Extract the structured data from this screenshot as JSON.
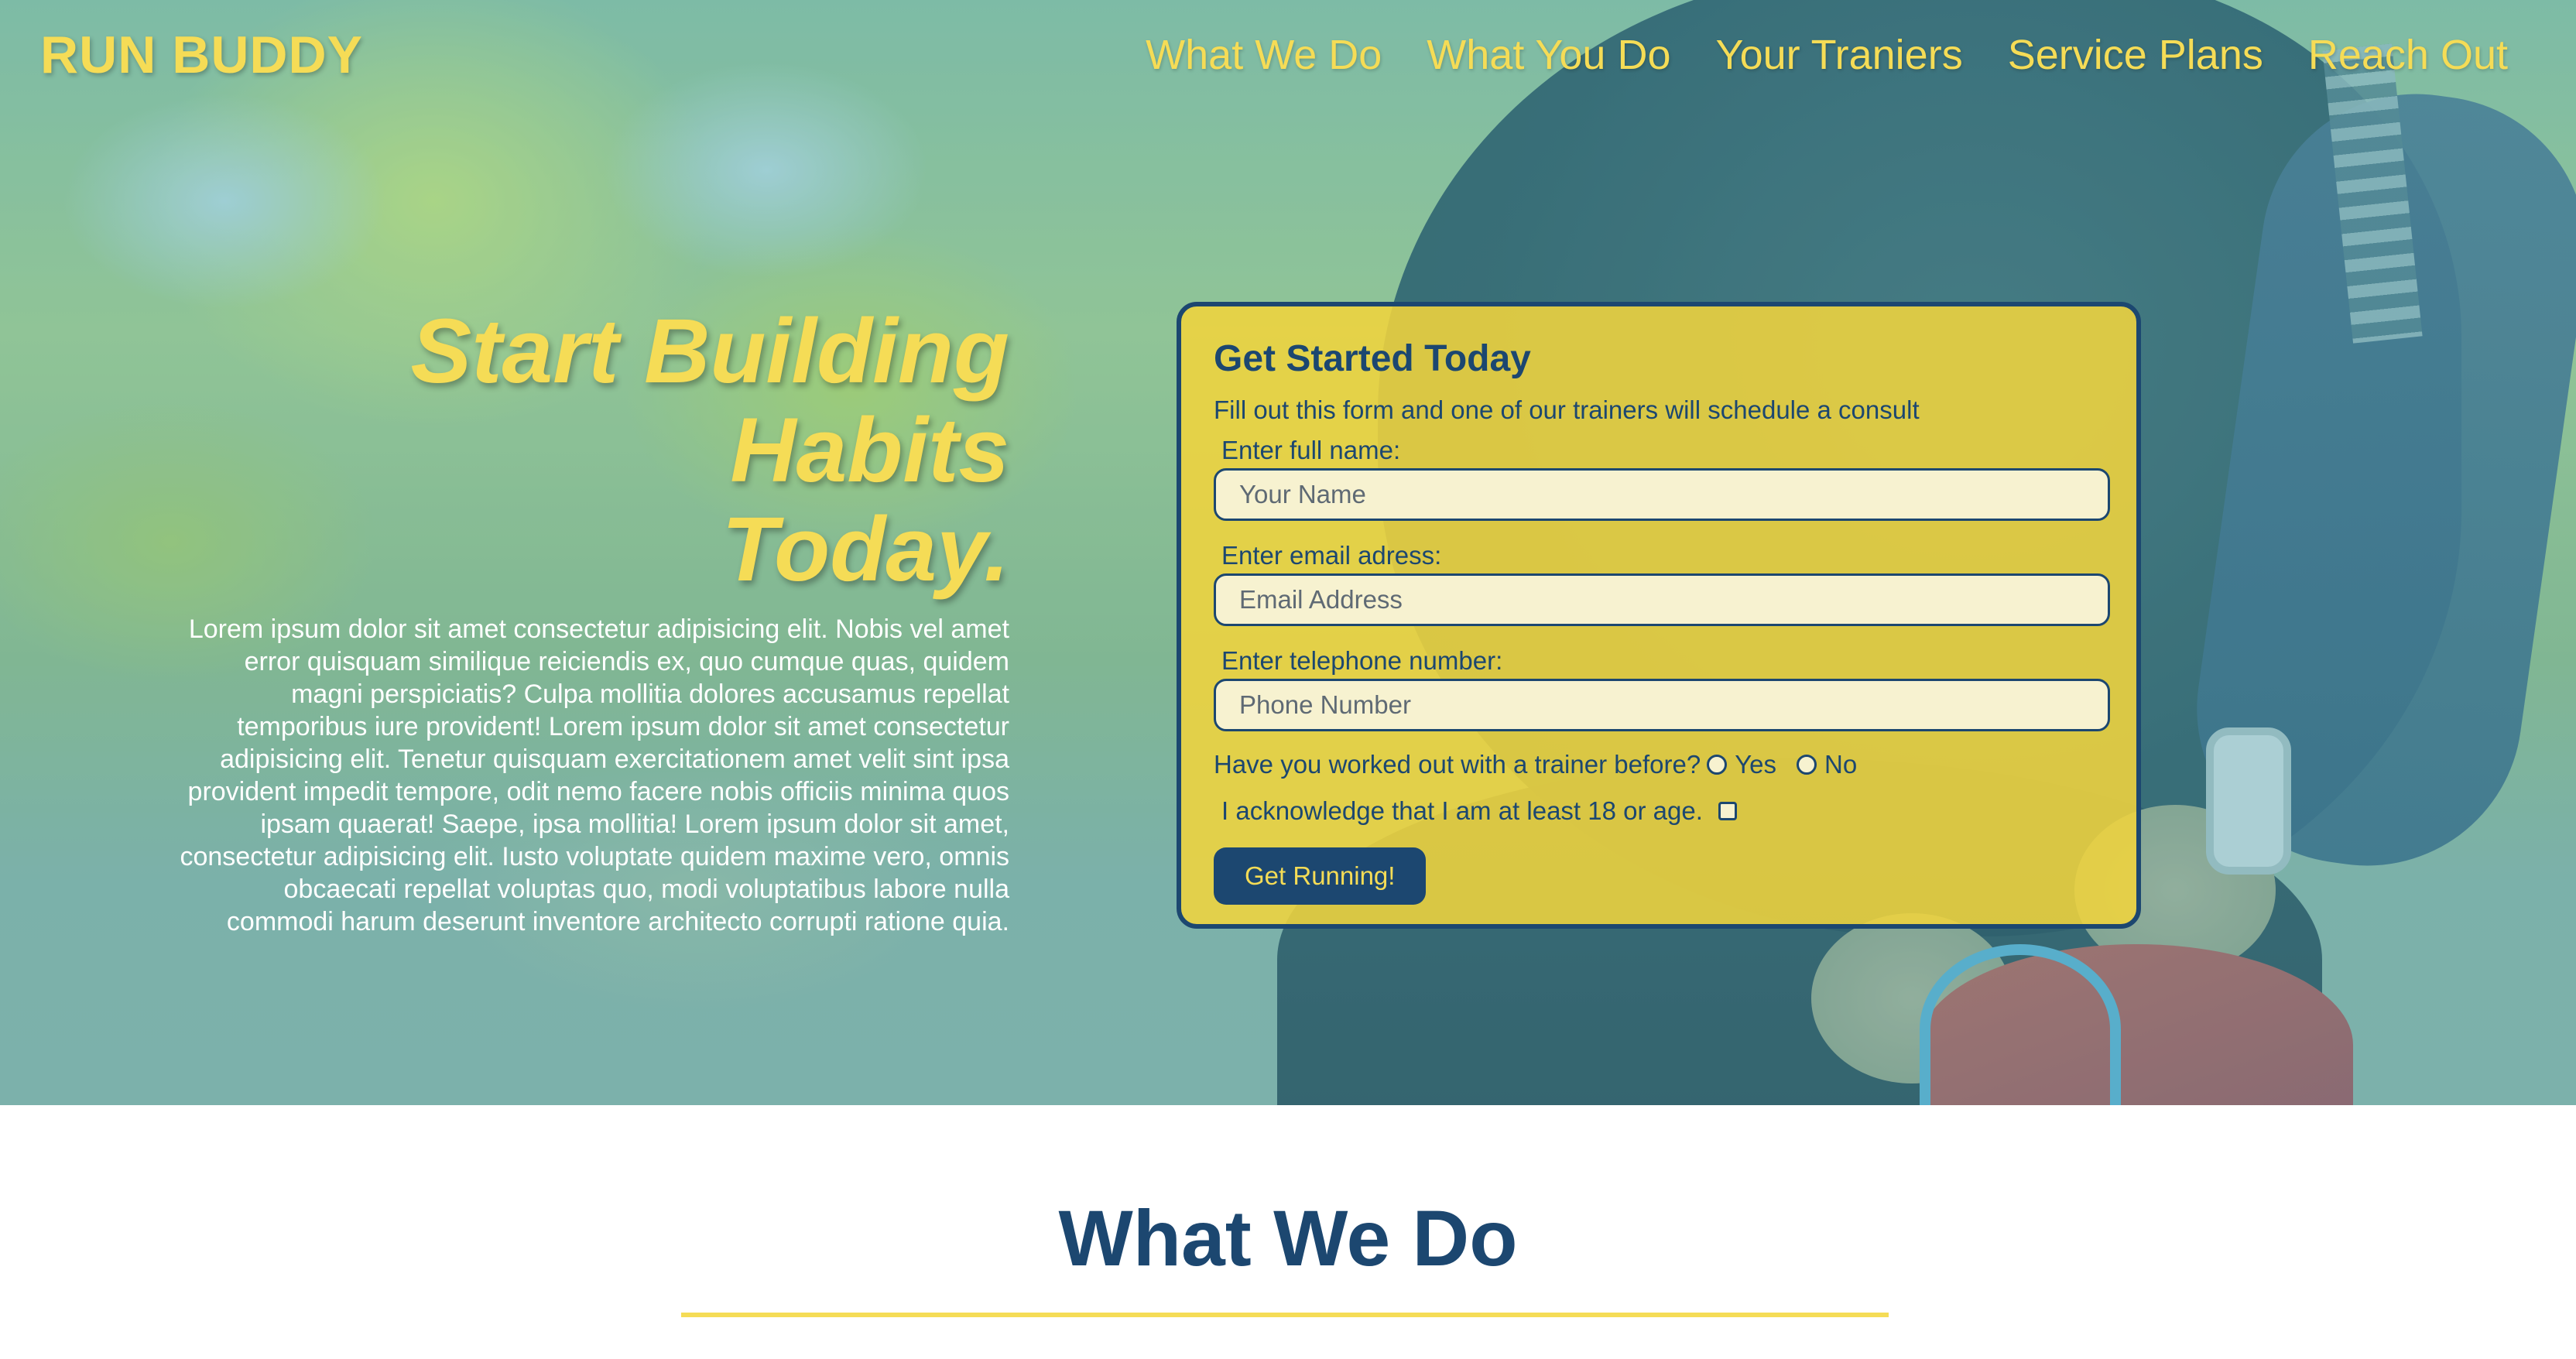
{
  "brand": "RUN BUDDY",
  "nav": [
    "What We Do",
    "What You Do",
    "Your Traniers",
    "Service Plans",
    "Reach Out"
  ],
  "hero": {
    "heading_line1": "Start Building Habits",
    "heading_line2": "Today.",
    "body": "Lorem ipsum dolor sit amet consectetur adipisicing elit. Nobis vel amet error quisquam similique reiciendis ex, quo cumque quas, quidem magni perspiciatis? Culpa mollitia dolores accusamus repellat temporibus iure provident! Lorem ipsum dolor sit amet consectetur adipisicing elit. Tenetur quisquam exercitationem amet velit sint ipsa provident impedit tempore, odit nemo facere nobis officiis minima quos ipsam quaerat! Saepe, ipsa mollitia! Lorem ipsum dolor sit amet, consectetur adipisicing elit. Iusto voluptate quidem maxime vero, omnis obcaecati repellat voluptas quo, modi voluptatibus labore nulla commodi harum deserunt inventore architecto corrupti ratione quia."
  },
  "form": {
    "title": "Get Started Today",
    "subtitle": "Fill out this form and one of our trainers will schedule a consult",
    "name_label": "Enter full name:",
    "name_placeholder": "Your Name",
    "email_label": "Enter email adress:",
    "email_placeholder": "Email Address",
    "phone_label": "Enter telephone number:",
    "phone_placeholder": "Phone Number",
    "trainer_question": "Have you worked out with a trainer before?",
    "yes_label": "Yes",
    "no_label": "No",
    "age_ack": "I acknowledge that I am at least 18 or age.",
    "submit": "Get Running!"
  },
  "section": {
    "title": "What We Do"
  },
  "colors": {
    "accent_yellow": "#f5dc56",
    "navy": "#1c4770"
  }
}
